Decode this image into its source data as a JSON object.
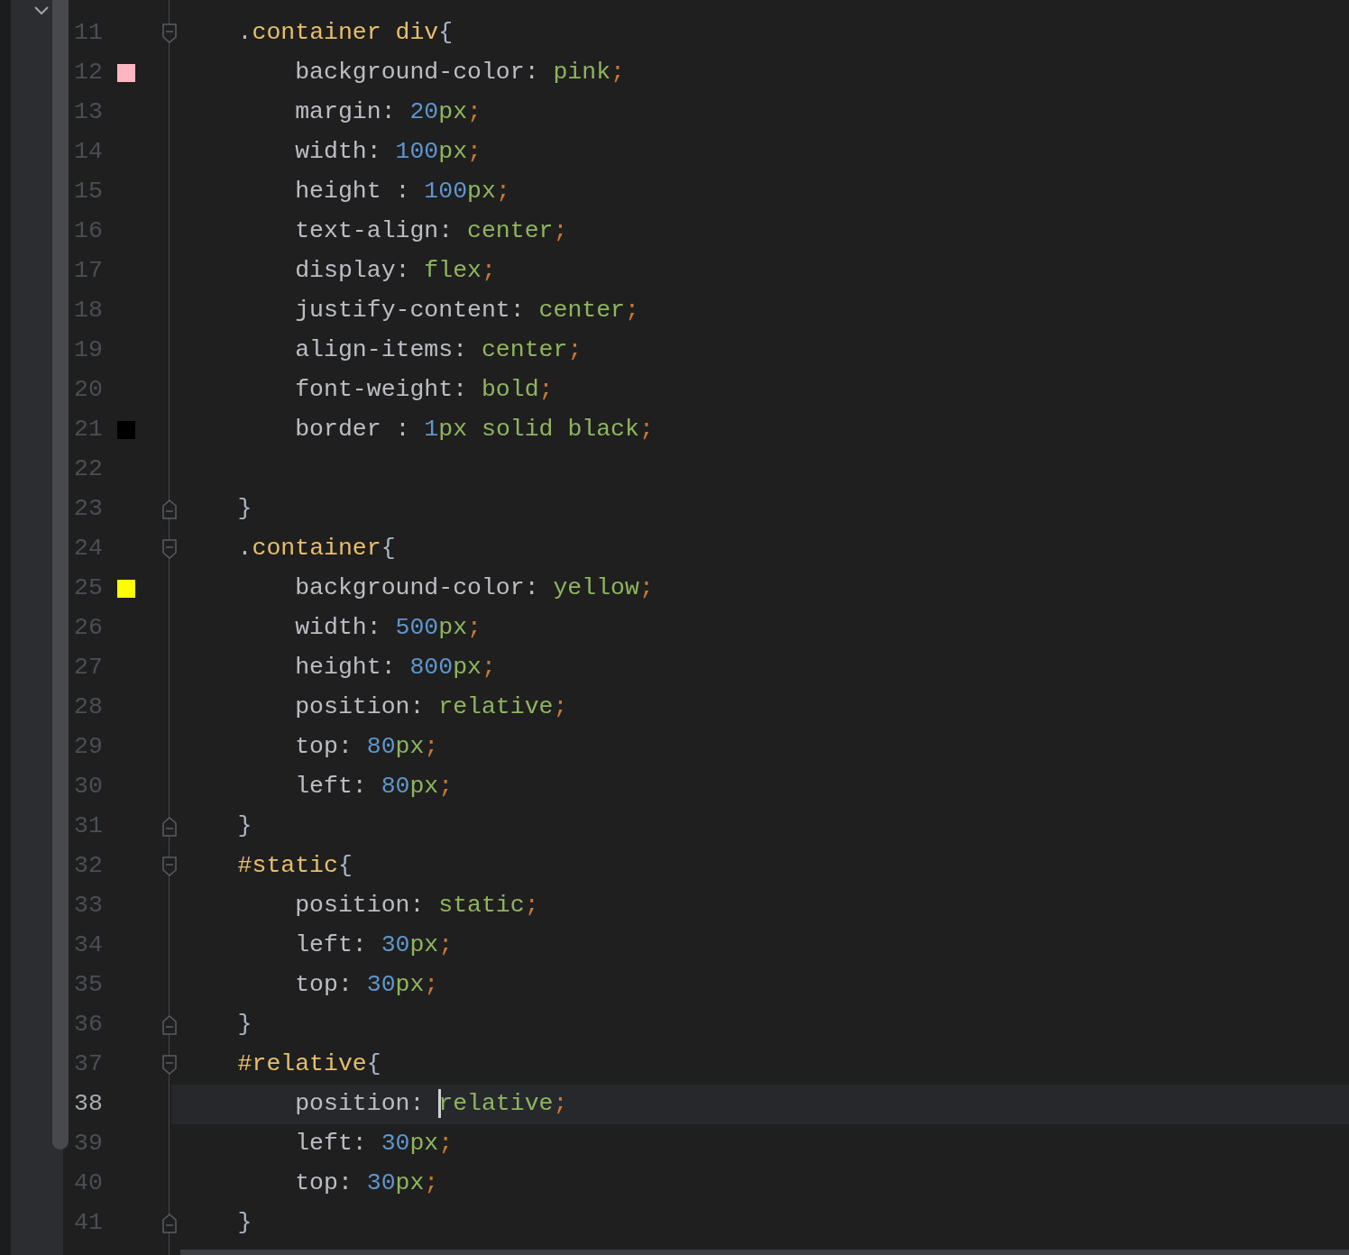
{
  "lines": [
    {
      "number": "11",
      "fold_start": true,
      "tokens": [
        {
          "text": "    .",
          "kind": "punct"
        },
        {
          "text": "container div",
          "kind": "selector"
        },
        {
          "text": "{",
          "kind": "brace"
        }
      ]
    },
    {
      "number": "12",
      "color": "#ffb6c1",
      "tokens": [
        {
          "text": "        background-color: ",
          "kind": "property"
        },
        {
          "text": "pink",
          "kind": "value"
        },
        {
          "text": ";",
          "kind": "semicolon"
        }
      ]
    },
    {
      "number": "13",
      "tokens": [
        {
          "text": "        margin: ",
          "kind": "property"
        },
        {
          "text": "20",
          "kind": "number"
        },
        {
          "text": "px",
          "kind": "value"
        },
        {
          "text": ";",
          "kind": "semicolon"
        }
      ]
    },
    {
      "number": "14",
      "tokens": [
        {
          "text": "        width: ",
          "kind": "property"
        },
        {
          "text": "100",
          "kind": "number"
        },
        {
          "text": "px",
          "kind": "value"
        },
        {
          "text": ";",
          "kind": "semicolon"
        }
      ]
    },
    {
      "number": "15",
      "tokens": [
        {
          "text": "        height : ",
          "kind": "property"
        },
        {
          "text": "100",
          "kind": "number"
        },
        {
          "text": "px",
          "kind": "value"
        },
        {
          "text": ";",
          "kind": "semicolon"
        }
      ]
    },
    {
      "number": "16",
      "tokens": [
        {
          "text": "        text-align: ",
          "kind": "property"
        },
        {
          "text": "center",
          "kind": "value"
        },
        {
          "text": ";",
          "kind": "semicolon"
        }
      ]
    },
    {
      "number": "17",
      "tokens": [
        {
          "text": "        display: ",
          "kind": "property"
        },
        {
          "text": "flex",
          "kind": "value"
        },
        {
          "text": ";",
          "kind": "semicolon"
        }
      ]
    },
    {
      "number": "18",
      "tokens": [
        {
          "text": "        justify-content: ",
          "kind": "property"
        },
        {
          "text": "center",
          "kind": "value"
        },
        {
          "text": ";",
          "kind": "semicolon"
        }
      ]
    },
    {
      "number": "19",
      "tokens": [
        {
          "text": "        align-items: ",
          "kind": "property"
        },
        {
          "text": "center",
          "kind": "value"
        },
        {
          "text": ";",
          "kind": "semicolon"
        }
      ]
    },
    {
      "number": "20",
      "tokens": [
        {
          "text": "        font-weight: ",
          "kind": "property"
        },
        {
          "text": "bold",
          "kind": "value"
        },
        {
          "text": ";",
          "kind": "semicolon"
        }
      ]
    },
    {
      "number": "21",
      "color": "#000000",
      "tokens": [
        {
          "text": "        border : ",
          "kind": "property"
        },
        {
          "text": "1",
          "kind": "number"
        },
        {
          "text": "px solid black",
          "kind": "value"
        },
        {
          "text": ";",
          "kind": "semicolon"
        }
      ]
    },
    {
      "number": "22"
    },
    {
      "number": "23",
      "fold_end": true,
      "tokens": [
        {
          "text": "    }",
          "kind": "brace"
        }
      ]
    },
    {
      "number": "24",
      "fold_start": true,
      "tokens": [
        {
          "text": "    .",
          "kind": "punct"
        },
        {
          "text": "container",
          "kind": "selector"
        },
        {
          "text": "{",
          "kind": "brace"
        }
      ]
    },
    {
      "number": "25",
      "color": "#ffff00",
      "tokens": [
        {
          "text": "        background-color: ",
          "kind": "property"
        },
        {
          "text": "yellow",
          "kind": "value"
        },
        {
          "text": ";",
          "kind": "semicolon"
        }
      ]
    },
    {
      "number": "26",
      "tokens": [
        {
          "text": "        width: ",
          "kind": "property"
        },
        {
          "text": "500",
          "kind": "number"
        },
        {
          "text": "px",
          "kind": "value"
        },
        {
          "text": ";",
          "kind": "semicolon"
        }
      ]
    },
    {
      "number": "27",
      "tokens": [
        {
          "text": "        height: ",
          "kind": "property"
        },
        {
          "text": "800",
          "kind": "number"
        },
        {
          "text": "px",
          "kind": "value"
        },
        {
          "text": ";",
          "kind": "semicolon"
        }
      ]
    },
    {
      "number": "28",
      "tokens": [
        {
          "text": "        position: ",
          "kind": "property"
        },
        {
          "text": "relative",
          "kind": "value"
        },
        {
          "text": ";",
          "kind": "semicolon"
        }
      ]
    },
    {
      "number": "29",
      "tokens": [
        {
          "text": "        top: ",
          "kind": "property"
        },
        {
          "text": "80",
          "kind": "number"
        },
        {
          "text": "px",
          "kind": "value"
        },
        {
          "text": ";",
          "kind": "semicolon"
        }
      ]
    },
    {
      "number": "30",
      "tokens": [
        {
          "text": "        left: ",
          "kind": "property"
        },
        {
          "text": "80",
          "kind": "number"
        },
        {
          "text": "px",
          "kind": "value"
        },
        {
          "text": ";",
          "kind": "semicolon"
        }
      ]
    },
    {
      "number": "31",
      "fold_end": true,
      "tokens": [
        {
          "text": "    }",
          "kind": "brace"
        }
      ]
    },
    {
      "number": "32",
      "fold_start": true,
      "tokens": [
        {
          "text": "    #static",
          "kind": "selector"
        },
        {
          "text": "{",
          "kind": "brace"
        }
      ]
    },
    {
      "number": "33",
      "tokens": [
        {
          "text": "        position: ",
          "kind": "property"
        },
        {
          "text": "static",
          "kind": "value"
        },
        {
          "text": ";",
          "kind": "semicolon"
        }
      ]
    },
    {
      "number": "34",
      "tokens": [
        {
          "text": "        left: ",
          "kind": "property"
        },
        {
          "text": "30",
          "kind": "number"
        },
        {
          "text": "px",
          "kind": "value"
        },
        {
          "text": ";",
          "kind": "semicolon"
        }
      ]
    },
    {
      "number": "35",
      "tokens": [
        {
          "text": "        top: ",
          "kind": "property"
        },
        {
          "text": "30",
          "kind": "number"
        },
        {
          "text": "px",
          "kind": "value"
        },
        {
          "text": ";",
          "kind": "semicolon"
        }
      ]
    },
    {
      "number": "36",
      "fold_end": true,
      "tokens": [
        {
          "text": "    }",
          "kind": "brace"
        }
      ]
    },
    {
      "number": "37",
      "fold_start": true,
      "tokens": [
        {
          "text": "    #relative",
          "kind": "selector"
        },
        {
          "text": "{",
          "kind": "brace"
        }
      ]
    },
    {
      "number": "38",
      "current": true,
      "tokens": [
        {
          "text": "        position: ",
          "kind": "property"
        },
        {
          "text": "relative",
          "kind": "value",
          "caret": true
        },
        {
          "text": ";",
          "kind": "semicolon"
        }
      ]
    },
    {
      "number": "39",
      "tokens": [
        {
          "text": "        left: ",
          "kind": "property"
        },
        {
          "text": "30",
          "kind": "number"
        },
        {
          "text": "px",
          "kind": "value"
        },
        {
          "text": ";",
          "kind": "semicolon"
        }
      ]
    },
    {
      "number": "40",
      "tokens": [
        {
          "text": "        top: ",
          "kind": "property"
        },
        {
          "text": "30",
          "kind": "number"
        },
        {
          "text": "px",
          "kind": "value"
        },
        {
          "text": ";",
          "kind": "semicolon"
        }
      ]
    },
    {
      "number": "41",
      "fold_end": true,
      "tokens": [
        {
          "text": "    }",
          "kind": "brace"
        }
      ]
    }
  ]
}
